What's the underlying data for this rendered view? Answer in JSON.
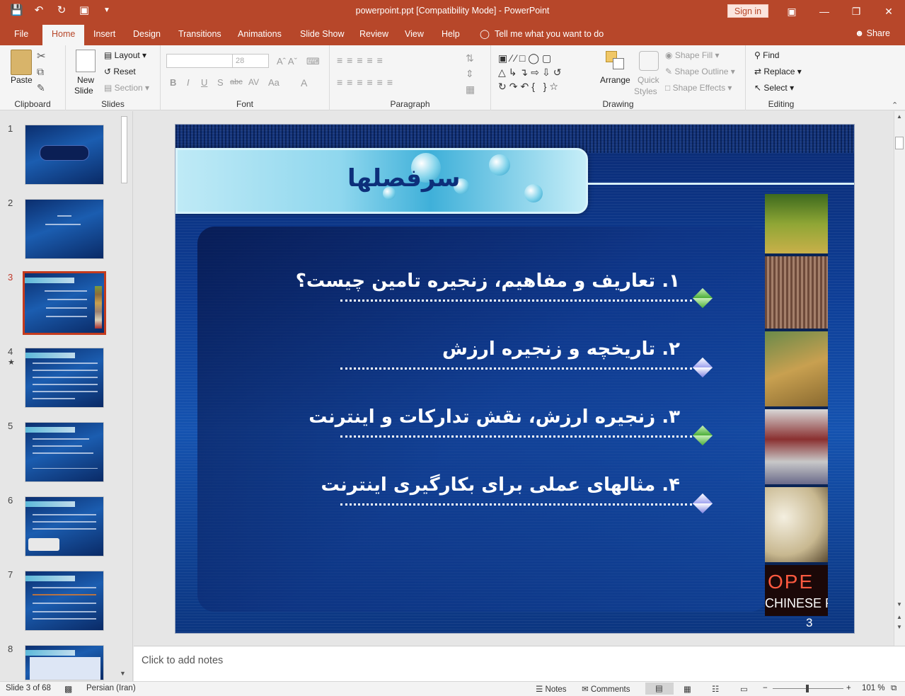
{
  "titlebar": {
    "document_title": "powerpoint.ppt [Compatibility Mode]  -  PowerPoint",
    "signin_label": "Sign in"
  },
  "tabs": [
    {
      "label": "File"
    },
    {
      "label": "Home"
    },
    {
      "label": "Insert"
    },
    {
      "label": "Design"
    },
    {
      "label": "Transitions"
    },
    {
      "label": "Animations"
    },
    {
      "label": "Slide Show"
    },
    {
      "label": "Review"
    },
    {
      "label": "View"
    },
    {
      "label": "Help"
    }
  ],
  "tellme": "Tell me what you want to do",
  "share": "Share",
  "ribbon": {
    "clipboard": {
      "paste": "Paste",
      "label": "Clipboard"
    },
    "slides": {
      "new_slide_1": "New",
      "new_slide_2": "Slide",
      "layout": "Layout",
      "reset": "Reset",
      "section": "Section",
      "label": "Slides"
    },
    "font": {
      "size": "28",
      "label": "Font"
    },
    "paragraph": {
      "label": "Paragraph"
    },
    "drawing": {
      "arrange": "Arrange",
      "quick_1": "Quick",
      "quick_2": "Styles",
      "shape_fill": "Shape Fill",
      "shape_outline": "Shape Outline",
      "shape_effects": "Shape Effects",
      "label": "Drawing"
    },
    "editing": {
      "find": "Find",
      "replace": "Replace",
      "select": "Select",
      "label": "Editing"
    }
  },
  "thumbnails": [
    {
      "num": "1",
      "marker": ""
    },
    {
      "num": "2",
      "marker": ""
    },
    {
      "num": "3",
      "marker": ""
    },
    {
      "num": "4",
      "marker": "★"
    },
    {
      "num": "5",
      "marker": ""
    },
    {
      "num": "6",
      "marker": ""
    },
    {
      "num": "7",
      "marker": ""
    },
    {
      "num": "8",
      "marker": ""
    }
  ],
  "slide": {
    "title": "سرفصلها",
    "bullets": [
      {
        "text": "۱. تعاریف و مفاهیم، زنجیره تامین چیست؟",
        "color": "green"
      },
      {
        "text": "۲. تاریخچه و زنجیره ارزش",
        "color": "violet"
      },
      {
        "text": "۳. زنجیره ارزش، نقش تدارکات و اینترنت",
        "color": "green"
      },
      {
        "text": "۴. مثالهای عملی برای بکارگیری اینترنت",
        "color": "violet"
      }
    ],
    "photo_text": {
      "line1": "OPE",
      "line2": "CHINESE FO"
    },
    "number": "3"
  },
  "notes_placeholder": "Click to add notes",
  "status": {
    "slide_info": "Slide 3 of 68",
    "language": "Persian (Iran)",
    "notes": "Notes",
    "comments": "Comments",
    "zoom": "101 %"
  },
  "colors": {
    "accent": "#b7472a",
    "slide_title": "#0d2f7a"
  }
}
